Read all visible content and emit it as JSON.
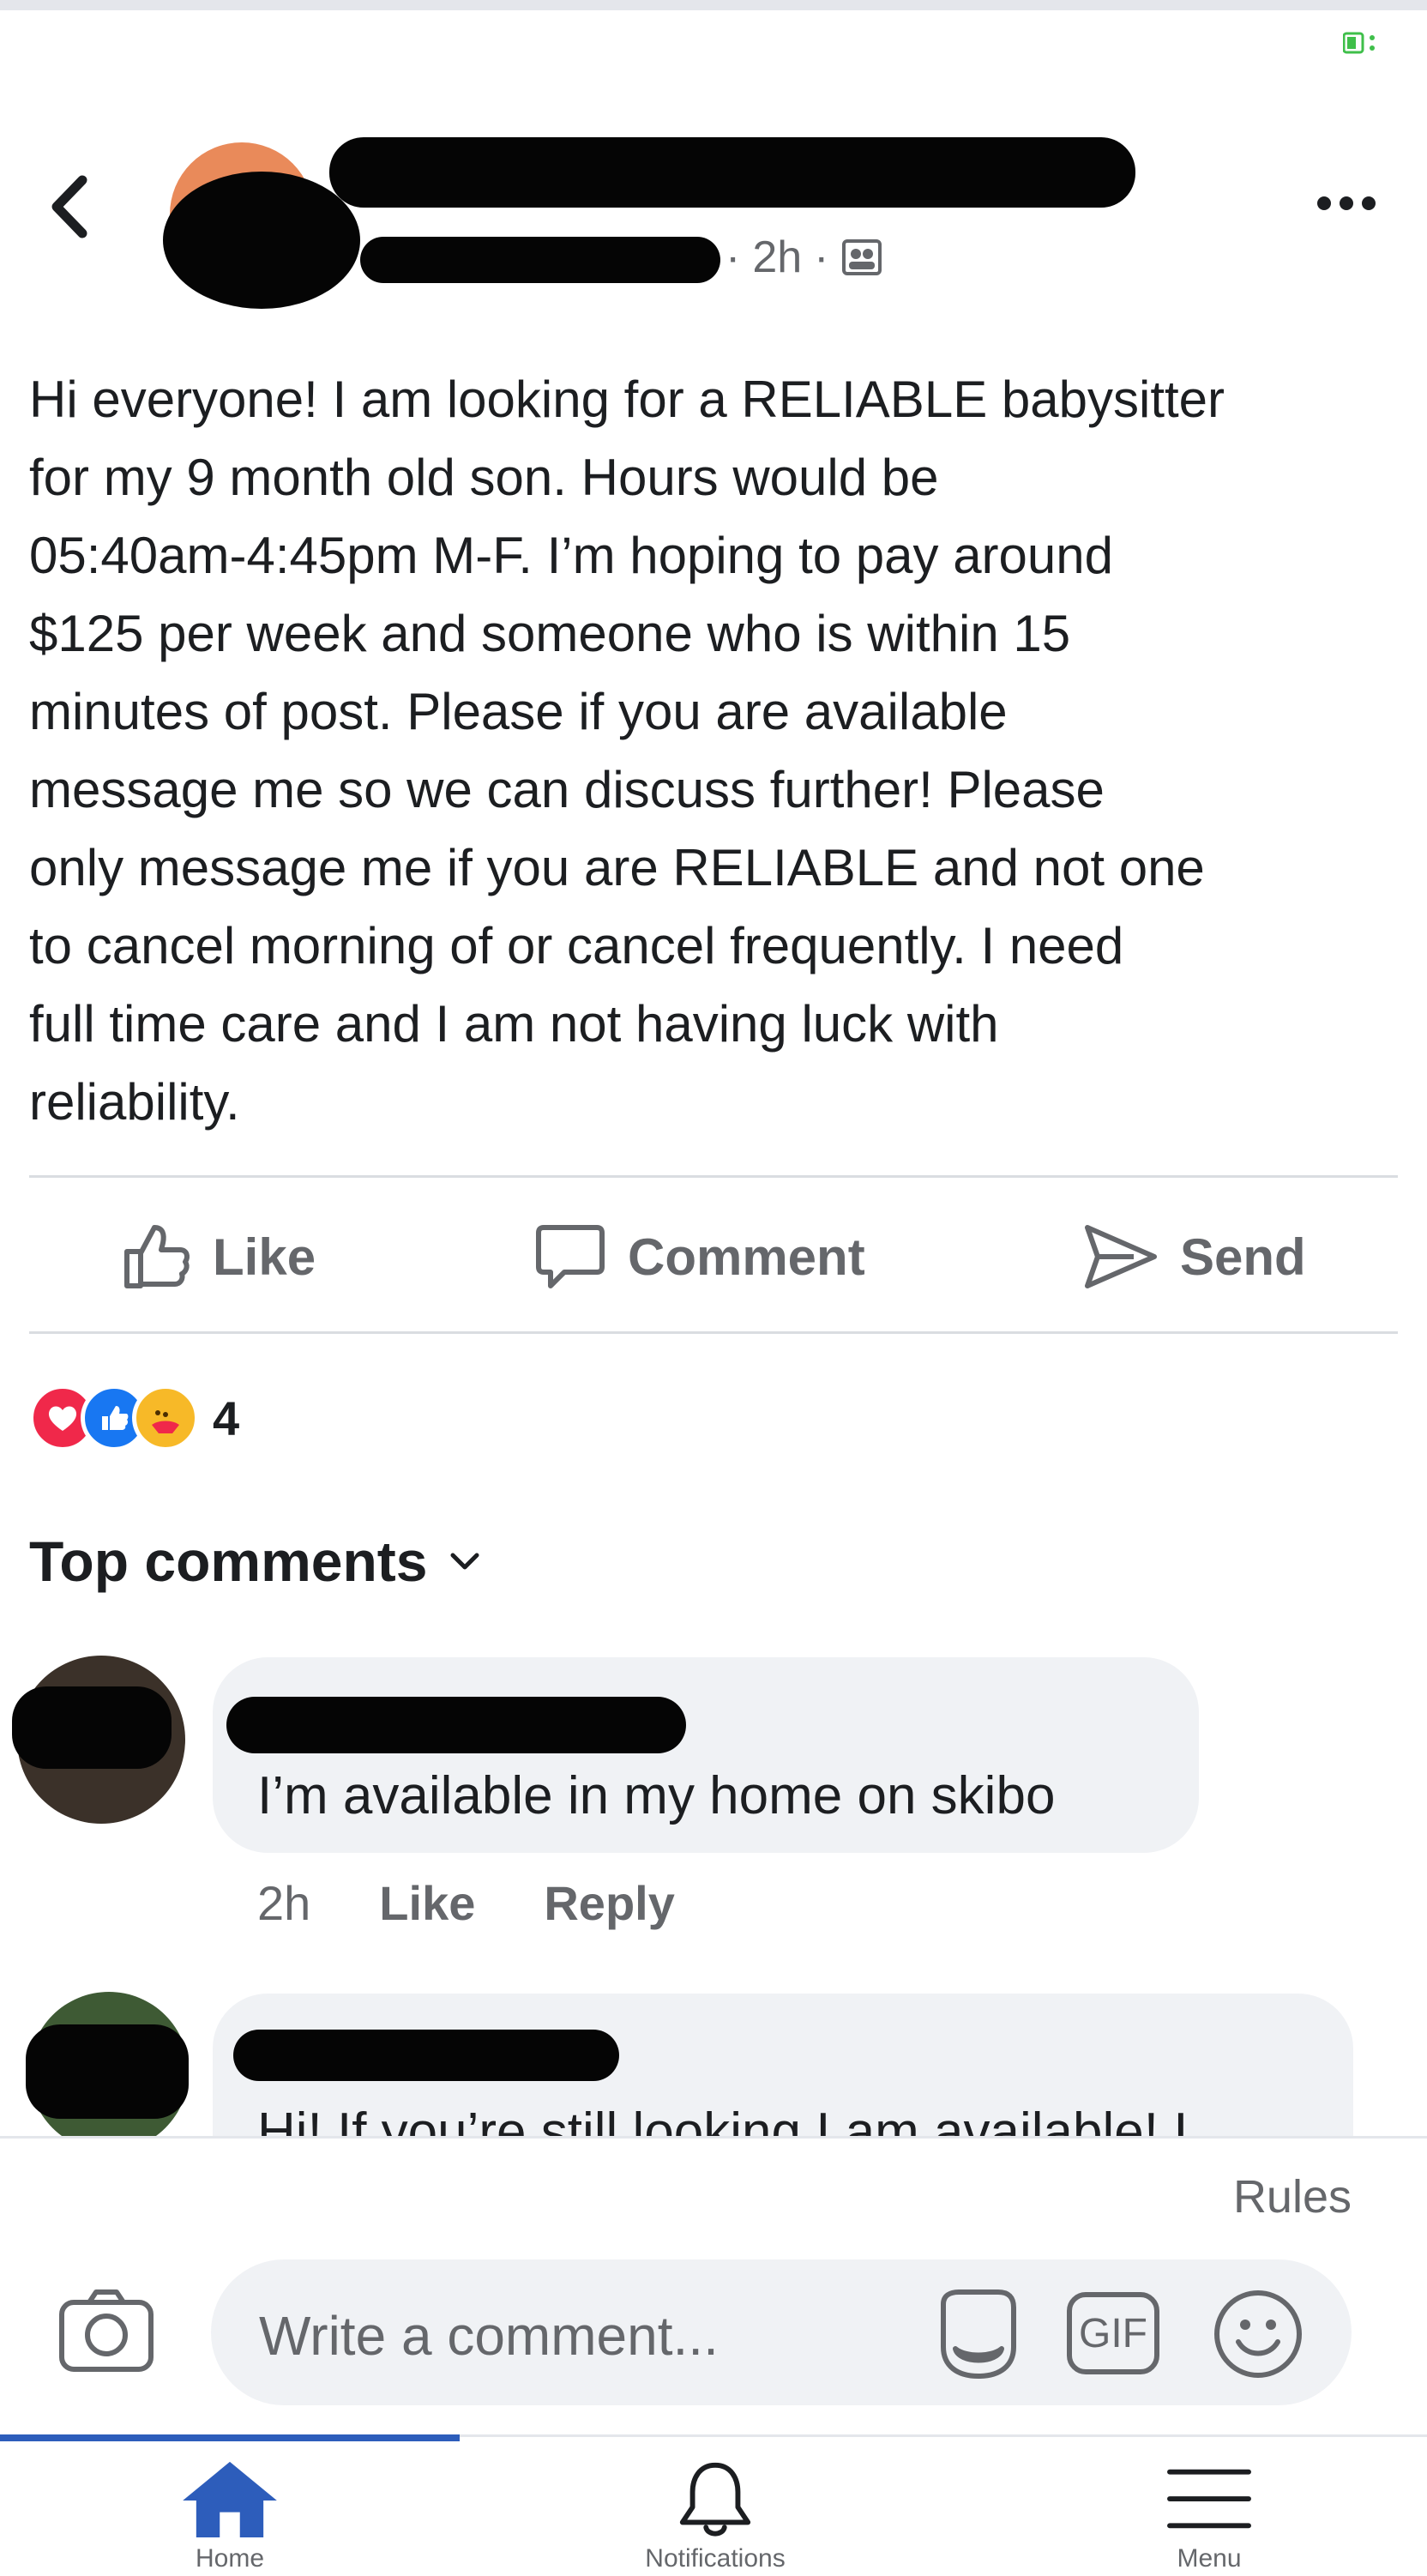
{
  "header": {
    "time": "2h",
    "separator": "·",
    "more_icon": "more-horizontal-icon",
    "back_icon": "chevron-left-icon",
    "audience_icon": "group-members-icon"
  },
  "post": {
    "body": "Hi everyone! I am looking for a RELIABLE babysitter\nfor my 9 month old son. Hours would be\n05:40am-4:45pm M-F. I’m hoping to pay around\n$125 per week and someone who is within 15\nminutes of post. Please if you are available\nmessage me so we can discuss further! Please\nonly message me if you are RELIABLE and not one\nto cancel morning of or cancel frequently. I need\nfull time care and I am not having luck with\nreliability."
  },
  "actions": {
    "like": "Like",
    "comment": "Comment",
    "send": "Send"
  },
  "reactions": {
    "count": "4",
    "types": [
      "love",
      "like",
      "care"
    ]
  },
  "comments_section": {
    "heading": "Top comments"
  },
  "comments": [
    {
      "text": "I’m available in my home on skibo",
      "time": "2h",
      "like": "Like",
      "reply": "Reply"
    },
    {
      "text": "Hi! If you’re still looking I am available! I"
    }
  ],
  "composer": {
    "rules": "Rules",
    "placeholder": "Write a comment...",
    "gif": "GIF"
  },
  "tabbar": {
    "home": "Home",
    "notifications": "Notifications",
    "menu": "Menu"
  },
  "colors": {
    "accent": "#2d5dbb",
    "text": "#1c1e21",
    "secondary": "#65676b",
    "bubble": "#f0f2f5",
    "love": "#f0284a",
    "like": "#1877f2",
    "care": "#f7b928"
  }
}
